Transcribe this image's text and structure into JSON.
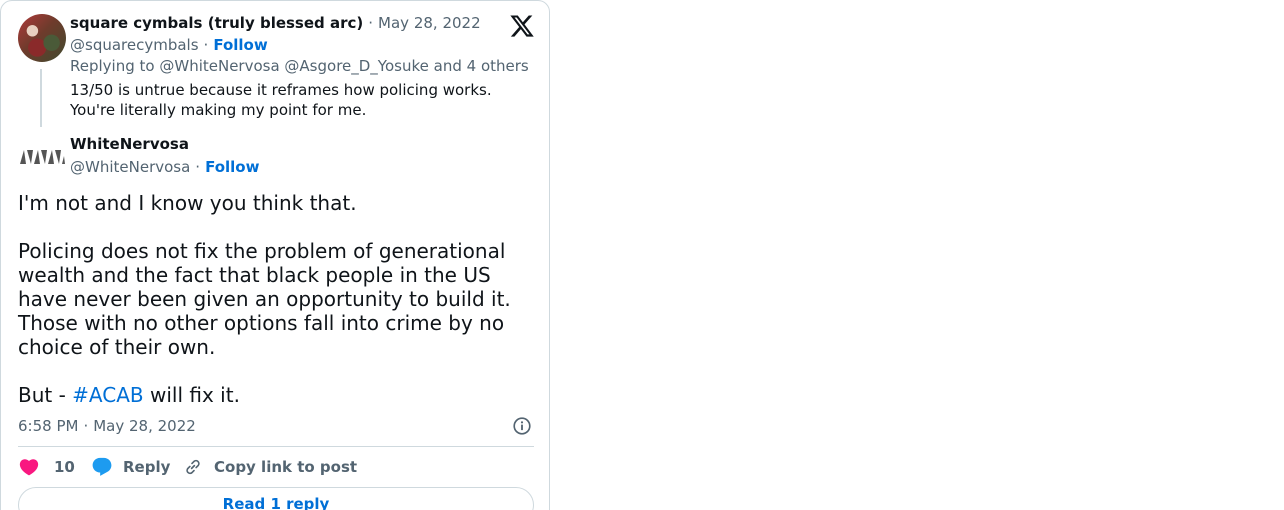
{
  "parent_tweet": {
    "display_name": "square cymbals (truly blessed arc)",
    "date": "May 28, 2022",
    "handle": "@squarecymbals",
    "follow_label": "Follow",
    "replying_prefix": "Replying to",
    "replying_to": "@WhiteNervosa @Asgore_D_Yosuke",
    "replying_suffix": "and 4 others",
    "text": "13/50 is untrue because it reframes how policing works. You're literally making my point for me."
  },
  "tweet": {
    "display_name": "WhiteNervosa",
    "handle": "@WhiteNervosa",
    "follow_label": "Follow",
    "body": "I'm not and I know you think that.\n\nPolicing does not fix the problem of generational wealth and the fact that black people in the US have never been given an opportunity to build it. Those with no other options fall into crime by no choice of their own.\n\n",
    "body_end_prefix": "But - ",
    "hashtag": "#ACAB",
    "body_end_suffix": " will fix it.",
    "time": "6:58 PM",
    "date": "May 28, 2022"
  },
  "actions": {
    "like_count": "10",
    "reply_label": "Reply",
    "copy_link_label": "Copy link to post"
  },
  "read_replies_label": "Read 1 reply",
  "icons": {
    "logo": "x-logo-icon",
    "info": "info-icon",
    "like": "heart-icon",
    "reply": "speech-bubble-icon",
    "copy": "link-icon"
  },
  "colors": {
    "accent": "#006fd6",
    "like": "#f91880",
    "reply": "#1d9bf0",
    "muted": "#536471",
    "border": "#cfd9de"
  }
}
